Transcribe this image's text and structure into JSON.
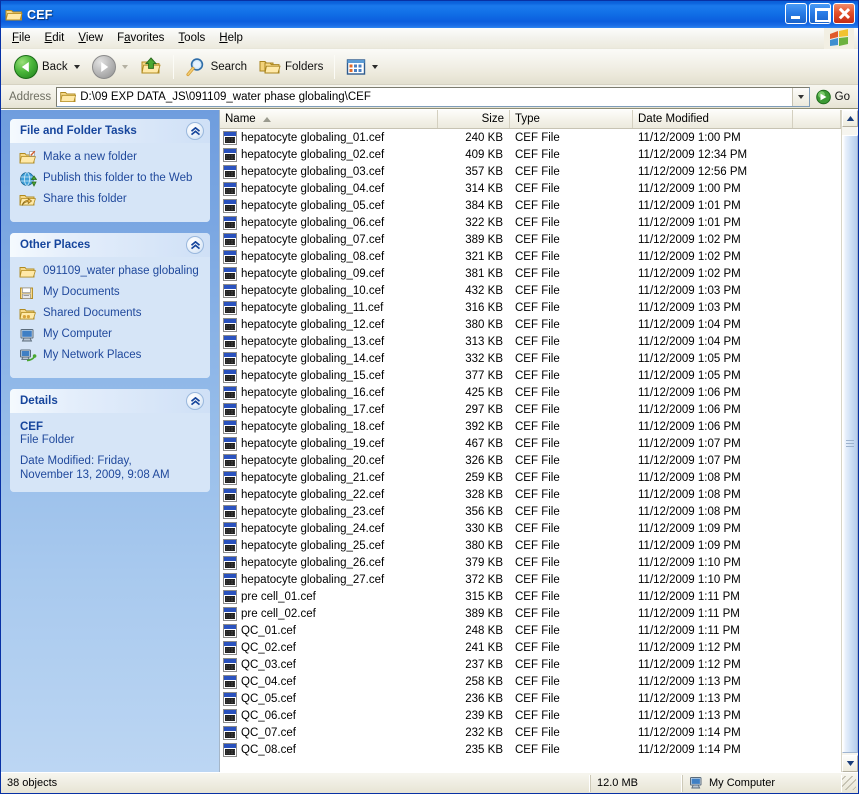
{
  "window": {
    "title": "CEF",
    "icon": "folder-icon",
    "minimize_label": "Minimize",
    "maximize_label": "Maximize",
    "close_label": "Close"
  },
  "menu": {
    "items": [
      {
        "label": "File",
        "accel": "F"
      },
      {
        "label": "Edit",
        "accel": "E"
      },
      {
        "label": "View",
        "accel": "V"
      },
      {
        "label": "Favorites",
        "accel": "a"
      },
      {
        "label": "Tools",
        "accel": "T"
      },
      {
        "label": "Help",
        "accel": "H"
      }
    ]
  },
  "toolbar": {
    "back_label": "Back",
    "forward_label": "Forward",
    "up_label": "Up",
    "search_label": "Search",
    "folders_label": "Folders",
    "views_label": "Views"
  },
  "address": {
    "label": "Address",
    "path": "D:\\09 EXP DATA_JS\\091109_water phase globaling\\CEF",
    "go_label": "Go"
  },
  "sidebar": {
    "panels": [
      {
        "title": "File and Folder Tasks",
        "items": [
          {
            "label": "Make a new folder",
            "icon": "new-folder-icon"
          },
          {
            "label": "Publish this folder to the Web",
            "icon": "publish-web-icon"
          },
          {
            "label": "Share this folder",
            "icon": "share-folder-icon"
          }
        ]
      },
      {
        "title": "Other Places",
        "items": [
          {
            "label": "091109_water phase globaling",
            "icon": "folder-icon"
          },
          {
            "label": "My Documents",
            "icon": "my-documents-icon"
          },
          {
            "label": "Shared Documents",
            "icon": "shared-documents-icon"
          },
          {
            "label": "My Computer",
            "icon": "my-computer-icon"
          },
          {
            "label": "My Network Places",
            "icon": "network-places-icon"
          }
        ]
      }
    ],
    "details": {
      "title": "Details",
      "name": "CEF",
      "kind": "File Folder",
      "date_modified": "Date Modified: Friday,",
      "date_modified_2": "November 13, 2009, 9:08 AM"
    }
  },
  "filelist": {
    "columns": [
      {
        "label": "Name",
        "sorted": "asc"
      },
      {
        "label": "Size"
      },
      {
        "label": "Type"
      },
      {
        "label": "Date Modified"
      }
    ],
    "rows": [
      {
        "name": "hepatocyte globaling_01.cef",
        "size": "240 KB",
        "type": "CEF File",
        "date": "11/12/2009 1:00 PM"
      },
      {
        "name": "hepatocyte globaling_02.cef",
        "size": "409 KB",
        "type": "CEF File",
        "date": "11/12/2009 12:34 PM"
      },
      {
        "name": "hepatocyte globaling_03.cef",
        "size": "357 KB",
        "type": "CEF File",
        "date": "11/12/2009 12:56 PM"
      },
      {
        "name": "hepatocyte globaling_04.cef",
        "size": "314 KB",
        "type": "CEF File",
        "date": "11/12/2009 1:00 PM"
      },
      {
        "name": "hepatocyte globaling_05.cef",
        "size": "384 KB",
        "type": "CEF File",
        "date": "11/12/2009 1:01 PM"
      },
      {
        "name": "hepatocyte globaling_06.cef",
        "size": "322 KB",
        "type": "CEF File",
        "date": "11/12/2009 1:01 PM"
      },
      {
        "name": "hepatocyte globaling_07.cef",
        "size": "389 KB",
        "type": "CEF File",
        "date": "11/12/2009 1:02 PM"
      },
      {
        "name": "hepatocyte globaling_08.cef",
        "size": "321 KB",
        "type": "CEF File",
        "date": "11/12/2009 1:02 PM"
      },
      {
        "name": "hepatocyte globaling_09.cef",
        "size": "381 KB",
        "type": "CEF File",
        "date": "11/12/2009 1:02 PM"
      },
      {
        "name": "hepatocyte globaling_10.cef",
        "size": "432 KB",
        "type": "CEF File",
        "date": "11/12/2009 1:03 PM"
      },
      {
        "name": "hepatocyte globaling_11.cef",
        "size": "316 KB",
        "type": "CEF File",
        "date": "11/12/2009 1:03 PM"
      },
      {
        "name": "hepatocyte globaling_12.cef",
        "size": "380 KB",
        "type": "CEF File",
        "date": "11/12/2009 1:04 PM"
      },
      {
        "name": "hepatocyte globaling_13.cef",
        "size": "313 KB",
        "type": "CEF File",
        "date": "11/12/2009 1:04 PM"
      },
      {
        "name": "hepatocyte globaling_14.cef",
        "size": "332 KB",
        "type": "CEF File",
        "date": "11/12/2009 1:05 PM"
      },
      {
        "name": "hepatocyte globaling_15.cef",
        "size": "377 KB",
        "type": "CEF File",
        "date": "11/12/2009 1:05 PM"
      },
      {
        "name": "hepatocyte globaling_16.cef",
        "size": "425 KB",
        "type": "CEF File",
        "date": "11/12/2009 1:06 PM"
      },
      {
        "name": "hepatocyte globaling_17.cef",
        "size": "297 KB",
        "type": "CEF File",
        "date": "11/12/2009 1:06 PM"
      },
      {
        "name": "hepatocyte globaling_18.cef",
        "size": "392 KB",
        "type": "CEF File",
        "date": "11/12/2009 1:06 PM"
      },
      {
        "name": "hepatocyte globaling_19.cef",
        "size": "467 KB",
        "type": "CEF File",
        "date": "11/12/2009 1:07 PM"
      },
      {
        "name": "hepatocyte globaling_20.cef",
        "size": "326 KB",
        "type": "CEF File",
        "date": "11/12/2009 1:07 PM"
      },
      {
        "name": "hepatocyte globaling_21.cef",
        "size": "259 KB",
        "type": "CEF File",
        "date": "11/12/2009 1:08 PM"
      },
      {
        "name": "hepatocyte globaling_22.cef",
        "size": "328 KB",
        "type": "CEF File",
        "date": "11/12/2009 1:08 PM"
      },
      {
        "name": "hepatocyte globaling_23.cef",
        "size": "356 KB",
        "type": "CEF File",
        "date": "11/12/2009 1:08 PM"
      },
      {
        "name": "hepatocyte globaling_24.cef",
        "size": "330 KB",
        "type": "CEF File",
        "date": "11/12/2009 1:09 PM"
      },
      {
        "name": "hepatocyte globaling_25.cef",
        "size": "380 KB",
        "type": "CEF File",
        "date": "11/12/2009 1:09 PM"
      },
      {
        "name": "hepatocyte globaling_26.cef",
        "size": "379 KB",
        "type": "CEF File",
        "date": "11/12/2009 1:10 PM"
      },
      {
        "name": "hepatocyte globaling_27.cef",
        "size": "372 KB",
        "type": "CEF File",
        "date": "11/12/2009 1:10 PM"
      },
      {
        "name": "pre cell_01.cef",
        "size": "315 KB",
        "type": "CEF File",
        "date": "11/12/2009 1:11 PM"
      },
      {
        "name": "pre cell_02.cef",
        "size": "389 KB",
        "type": "CEF File",
        "date": "11/12/2009 1:11 PM"
      },
      {
        "name": "QC_01.cef",
        "size": "248 KB",
        "type": "CEF File",
        "date": "11/12/2009 1:11 PM"
      },
      {
        "name": "QC_02.cef",
        "size": "241 KB",
        "type": "CEF File",
        "date": "11/12/2009 1:12 PM"
      },
      {
        "name": "QC_03.cef",
        "size": "237 KB",
        "type": "CEF File",
        "date": "11/12/2009 1:12 PM"
      },
      {
        "name": "QC_04.cef",
        "size": "258 KB",
        "type": "CEF File",
        "date": "11/12/2009 1:13 PM"
      },
      {
        "name": "QC_05.cef",
        "size": "236 KB",
        "type": "CEF File",
        "date": "11/12/2009 1:13 PM"
      },
      {
        "name": "QC_06.cef",
        "size": "239 KB",
        "type": "CEF File",
        "date": "11/12/2009 1:13 PM"
      },
      {
        "name": "QC_07.cef",
        "size": "232 KB",
        "type": "CEF File",
        "date": "11/12/2009 1:14 PM"
      },
      {
        "name": "QC_08.cef",
        "size": "235 KB",
        "type": "CEF File",
        "date": "11/12/2009 1:14 PM"
      }
    ]
  },
  "statusbar": {
    "objects": "38 objects",
    "size": "12.0 MB",
    "place": "My Computer"
  },
  "colors": {
    "titlebar_blue": "#0f6ae4",
    "sidebar_blue": "#94bbe9",
    "panel_body": "#d6e5f7",
    "link_text": "#20499c",
    "panel_title": "#16459c",
    "close_red": "#e4512a"
  }
}
